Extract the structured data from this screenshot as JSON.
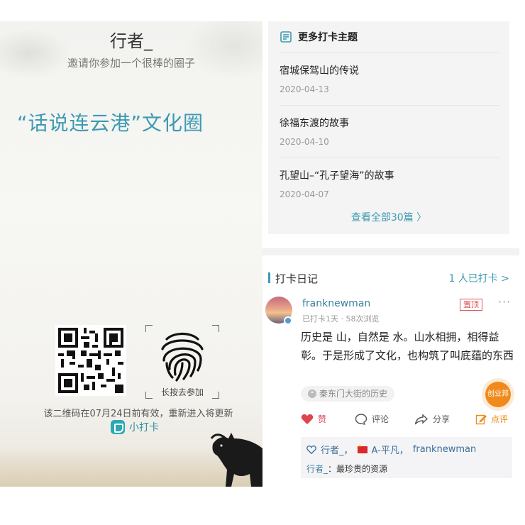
{
  "poster": {
    "user_name": "行者_",
    "invite_text": "邀请你参加一个很棒的圈子",
    "circle_title": "“话说连云港”文化圈",
    "fingerprint_label": "长按去参加",
    "qr_note": "该二维码在07月24日前有效，重新进入将更新",
    "brand_name": "小打卡"
  },
  "topics": {
    "header": "更多打卡主题",
    "items": [
      {
        "title": "宿城保驾山的传说",
        "date": "2020-04-13"
      },
      {
        "title": "徐福东渡的故事",
        "date": "2020-04-10"
      },
      {
        "title": "孔望山–“孔子望海”的故事",
        "date": "2020-04-07"
      }
    ],
    "view_all": "查看全部30篇 〉"
  },
  "diary": {
    "title": "打卡日记",
    "count_text": "1 人已打卡 >",
    "post": {
      "author": "franknewman",
      "meta": "已打卡1天 · 58次浏览",
      "pin_label": "置顶",
      "more": "···",
      "body": "历史是 山，自然是 水。山水相拥，相得益彰。于是形成了文化，也构筑了叫底蕴的东西",
      "tag": "秦东门大街的历史",
      "float_button": "创业邦",
      "actions": {
        "like": "赞",
        "comment": "评论",
        "share": "分享",
        "review": "点评"
      },
      "likes": [
        "行者_，",
        "A-平凡，",
        "franknewman"
      ],
      "comment": {
        "name": "行者_",
        "text": "：最珍贵的资源"
      }
    }
  },
  "colors": {
    "accent": "#3c9ab2",
    "like_red": "#e0434f",
    "review_orange": "#f08a1c"
  }
}
